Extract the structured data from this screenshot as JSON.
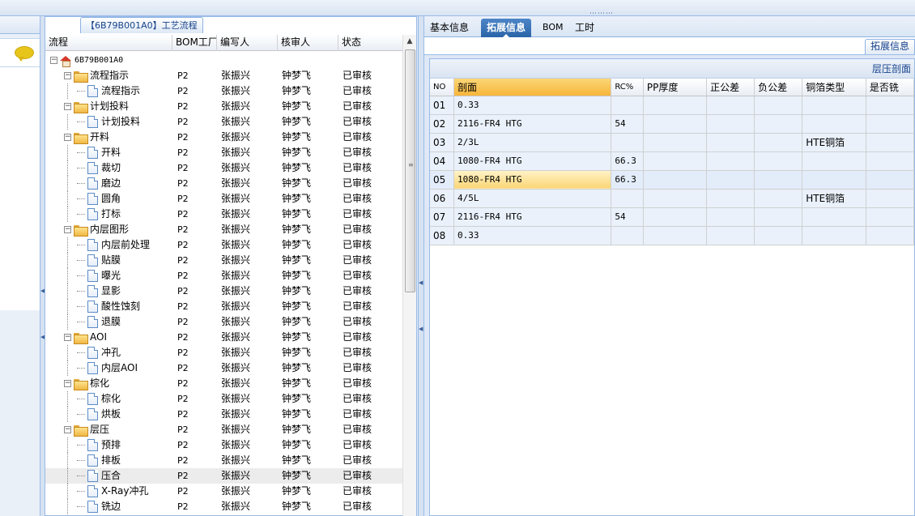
{
  "window": {
    "grip": "⋯⋯⋯"
  },
  "left_tree_panel": {
    "title": "【6B79B001A0】工艺流程",
    "columns": [
      "流程",
      "BOM工厂",
      "编写人",
      "核审人",
      "状态"
    ],
    "rows": [
      {
        "label": "6B79B001A0",
        "type": "root",
        "level": 0,
        "bom": "",
        "writer": "",
        "reviewer": "",
        "status": ""
      },
      {
        "label": "流程指示",
        "type": "folder",
        "level": 1,
        "bom": "P2",
        "writer": "张振兴",
        "reviewer": "钟梦飞",
        "status": "已审核"
      },
      {
        "label": "流程指示",
        "type": "doc",
        "level": 2,
        "bom": "P2",
        "writer": "张振兴",
        "reviewer": "钟梦飞",
        "status": "已审核"
      },
      {
        "label": "计划投料",
        "type": "folder",
        "level": 1,
        "bom": "P2",
        "writer": "张振兴",
        "reviewer": "钟梦飞",
        "status": "已审核"
      },
      {
        "label": "计划投料",
        "type": "doc",
        "level": 2,
        "bom": "P2",
        "writer": "张振兴",
        "reviewer": "钟梦飞",
        "status": "已审核"
      },
      {
        "label": "开料",
        "type": "folder",
        "level": 1,
        "bom": "P2",
        "writer": "张振兴",
        "reviewer": "钟梦飞",
        "status": "已审核"
      },
      {
        "label": "开料",
        "type": "doc",
        "level": 2,
        "bom": "P2",
        "writer": "张振兴",
        "reviewer": "钟梦飞",
        "status": "已审核"
      },
      {
        "label": "裁切",
        "type": "doc",
        "level": 2,
        "bom": "P2",
        "writer": "张振兴",
        "reviewer": "钟梦飞",
        "status": "已审核"
      },
      {
        "label": "磨边",
        "type": "doc",
        "level": 2,
        "bom": "P2",
        "writer": "张振兴",
        "reviewer": "钟梦飞",
        "status": "已审核"
      },
      {
        "label": "圆角",
        "type": "doc",
        "level": 2,
        "bom": "P2",
        "writer": "张振兴",
        "reviewer": "钟梦飞",
        "status": "已审核"
      },
      {
        "label": "打标",
        "type": "doc",
        "level": 2,
        "bom": "P2",
        "writer": "张振兴",
        "reviewer": "钟梦飞",
        "status": "已审核"
      },
      {
        "label": "内层图形",
        "type": "folder",
        "level": 1,
        "bom": "P2",
        "writer": "张振兴",
        "reviewer": "钟梦飞",
        "status": "已审核"
      },
      {
        "label": "内层前处理",
        "type": "doc",
        "level": 2,
        "bom": "P2",
        "writer": "张振兴",
        "reviewer": "钟梦飞",
        "status": "已审核"
      },
      {
        "label": "贴膜",
        "type": "doc",
        "level": 2,
        "bom": "P2",
        "writer": "张振兴",
        "reviewer": "钟梦飞",
        "status": "已审核"
      },
      {
        "label": "曝光",
        "type": "doc",
        "level": 2,
        "bom": "P2",
        "writer": "张振兴",
        "reviewer": "钟梦飞",
        "status": "已审核"
      },
      {
        "label": "显影",
        "type": "doc",
        "level": 2,
        "bom": "P2",
        "writer": "张振兴",
        "reviewer": "钟梦飞",
        "status": "已审核"
      },
      {
        "label": "酸性蚀刻",
        "type": "doc",
        "level": 2,
        "bom": "P2",
        "writer": "张振兴",
        "reviewer": "钟梦飞",
        "status": "已审核"
      },
      {
        "label": "退膜",
        "type": "doc",
        "level": 2,
        "bom": "P2",
        "writer": "张振兴",
        "reviewer": "钟梦飞",
        "status": "已审核"
      },
      {
        "label": "AOI",
        "type": "folder",
        "level": 1,
        "bom": "P2",
        "writer": "张振兴",
        "reviewer": "钟梦飞",
        "status": "已审核"
      },
      {
        "label": "冲孔",
        "type": "doc",
        "level": 2,
        "bom": "P2",
        "writer": "张振兴",
        "reviewer": "钟梦飞",
        "status": "已审核"
      },
      {
        "label": "内层AOI",
        "type": "doc",
        "level": 2,
        "bom": "P2",
        "writer": "张振兴",
        "reviewer": "钟梦飞",
        "status": "已审核"
      },
      {
        "label": "棕化",
        "type": "folder",
        "level": 1,
        "bom": "P2",
        "writer": "张振兴",
        "reviewer": "钟梦飞",
        "status": "已审核"
      },
      {
        "label": "棕化",
        "type": "doc",
        "level": 2,
        "bom": "P2",
        "writer": "张振兴",
        "reviewer": "钟梦飞",
        "status": "已审核"
      },
      {
        "label": "烘板",
        "type": "doc",
        "level": 2,
        "bom": "P2",
        "writer": "张振兴",
        "reviewer": "钟梦飞",
        "status": "已审核"
      },
      {
        "label": "层压",
        "type": "folder",
        "level": 1,
        "bom": "P2",
        "writer": "张振兴",
        "reviewer": "钟梦飞",
        "status": "已审核"
      },
      {
        "label": "预排",
        "type": "doc",
        "level": 2,
        "bom": "P2",
        "writer": "张振兴",
        "reviewer": "钟梦飞",
        "status": "已审核"
      },
      {
        "label": "排板",
        "type": "doc",
        "level": 2,
        "bom": "P2",
        "writer": "张振兴",
        "reviewer": "钟梦飞",
        "status": "已审核"
      },
      {
        "label": "压合",
        "type": "doc",
        "level": 2,
        "bom": "P2",
        "writer": "张振兴",
        "reviewer": "钟梦飞",
        "status": "已审核",
        "selected": true
      },
      {
        "label": "X-Ray冲孔",
        "type": "doc",
        "level": 2,
        "bom": "P2",
        "writer": "张振兴",
        "reviewer": "钟梦飞",
        "status": "已审核"
      },
      {
        "label": "铣边",
        "type": "doc",
        "level": 2,
        "bom": "P2",
        "writer": "张振兴",
        "reviewer": "钟梦飞",
        "status": "已审核"
      }
    ]
  },
  "right_panel": {
    "tabs": [
      {
        "label": "基本信息",
        "active": false
      },
      {
        "label": "拓展信息",
        "active": true
      },
      {
        "label": "BOM",
        "active": false
      },
      {
        "label": "工时",
        "active": false
      }
    ],
    "subtab": "拓展信息",
    "grid_title": "层压剖面",
    "columns": [
      "NO",
      "剖面",
      "RC%",
      "PP厚度",
      "正公差",
      "负公差",
      "铜箔类型",
      "是否铣"
    ],
    "rows": [
      {
        "no": "01",
        "profile": "0.33",
        "rc": "",
        "pp": "",
        "plus": "",
        "minus": "",
        "foil": "",
        "mill": ""
      },
      {
        "no": "02",
        "profile": "2116-FR4 HTG",
        "rc": "54",
        "pp": "",
        "plus": "",
        "minus": "",
        "foil": "",
        "mill": ""
      },
      {
        "no": "03",
        "profile": "2/3L",
        "rc": "",
        "pp": "",
        "plus": "",
        "minus": "",
        "foil": "HTE铜箔",
        "mill": ""
      },
      {
        "no": "04",
        "profile": "1080-FR4 HTG",
        "rc": "66.3",
        "pp": "",
        "plus": "",
        "minus": "",
        "foil": "",
        "mill": ""
      },
      {
        "no": "05",
        "profile": "1080-FR4 HTG",
        "rc": "66.3",
        "pp": "",
        "plus": "",
        "minus": "",
        "foil": "",
        "mill": "",
        "selected": true
      },
      {
        "no": "06",
        "profile": "4/5L",
        "rc": "",
        "pp": "",
        "plus": "",
        "minus": "",
        "foil": "HTE铜箔",
        "mill": ""
      },
      {
        "no": "07",
        "profile": "2116-FR4 HTG",
        "rc": "54",
        "pp": "",
        "plus": "",
        "minus": "",
        "foil": "",
        "mill": ""
      },
      {
        "no": "08",
        "profile": "0.33",
        "rc": "",
        "pp": "",
        "plus": "",
        "minus": "",
        "foil": "",
        "mill": ""
      }
    ]
  },
  "icons": [
    "chat-bubble-icon",
    "home-icon",
    "folder-icon",
    "document-icon",
    "collapse-arrow-icon",
    "scroll-up-icon"
  ]
}
